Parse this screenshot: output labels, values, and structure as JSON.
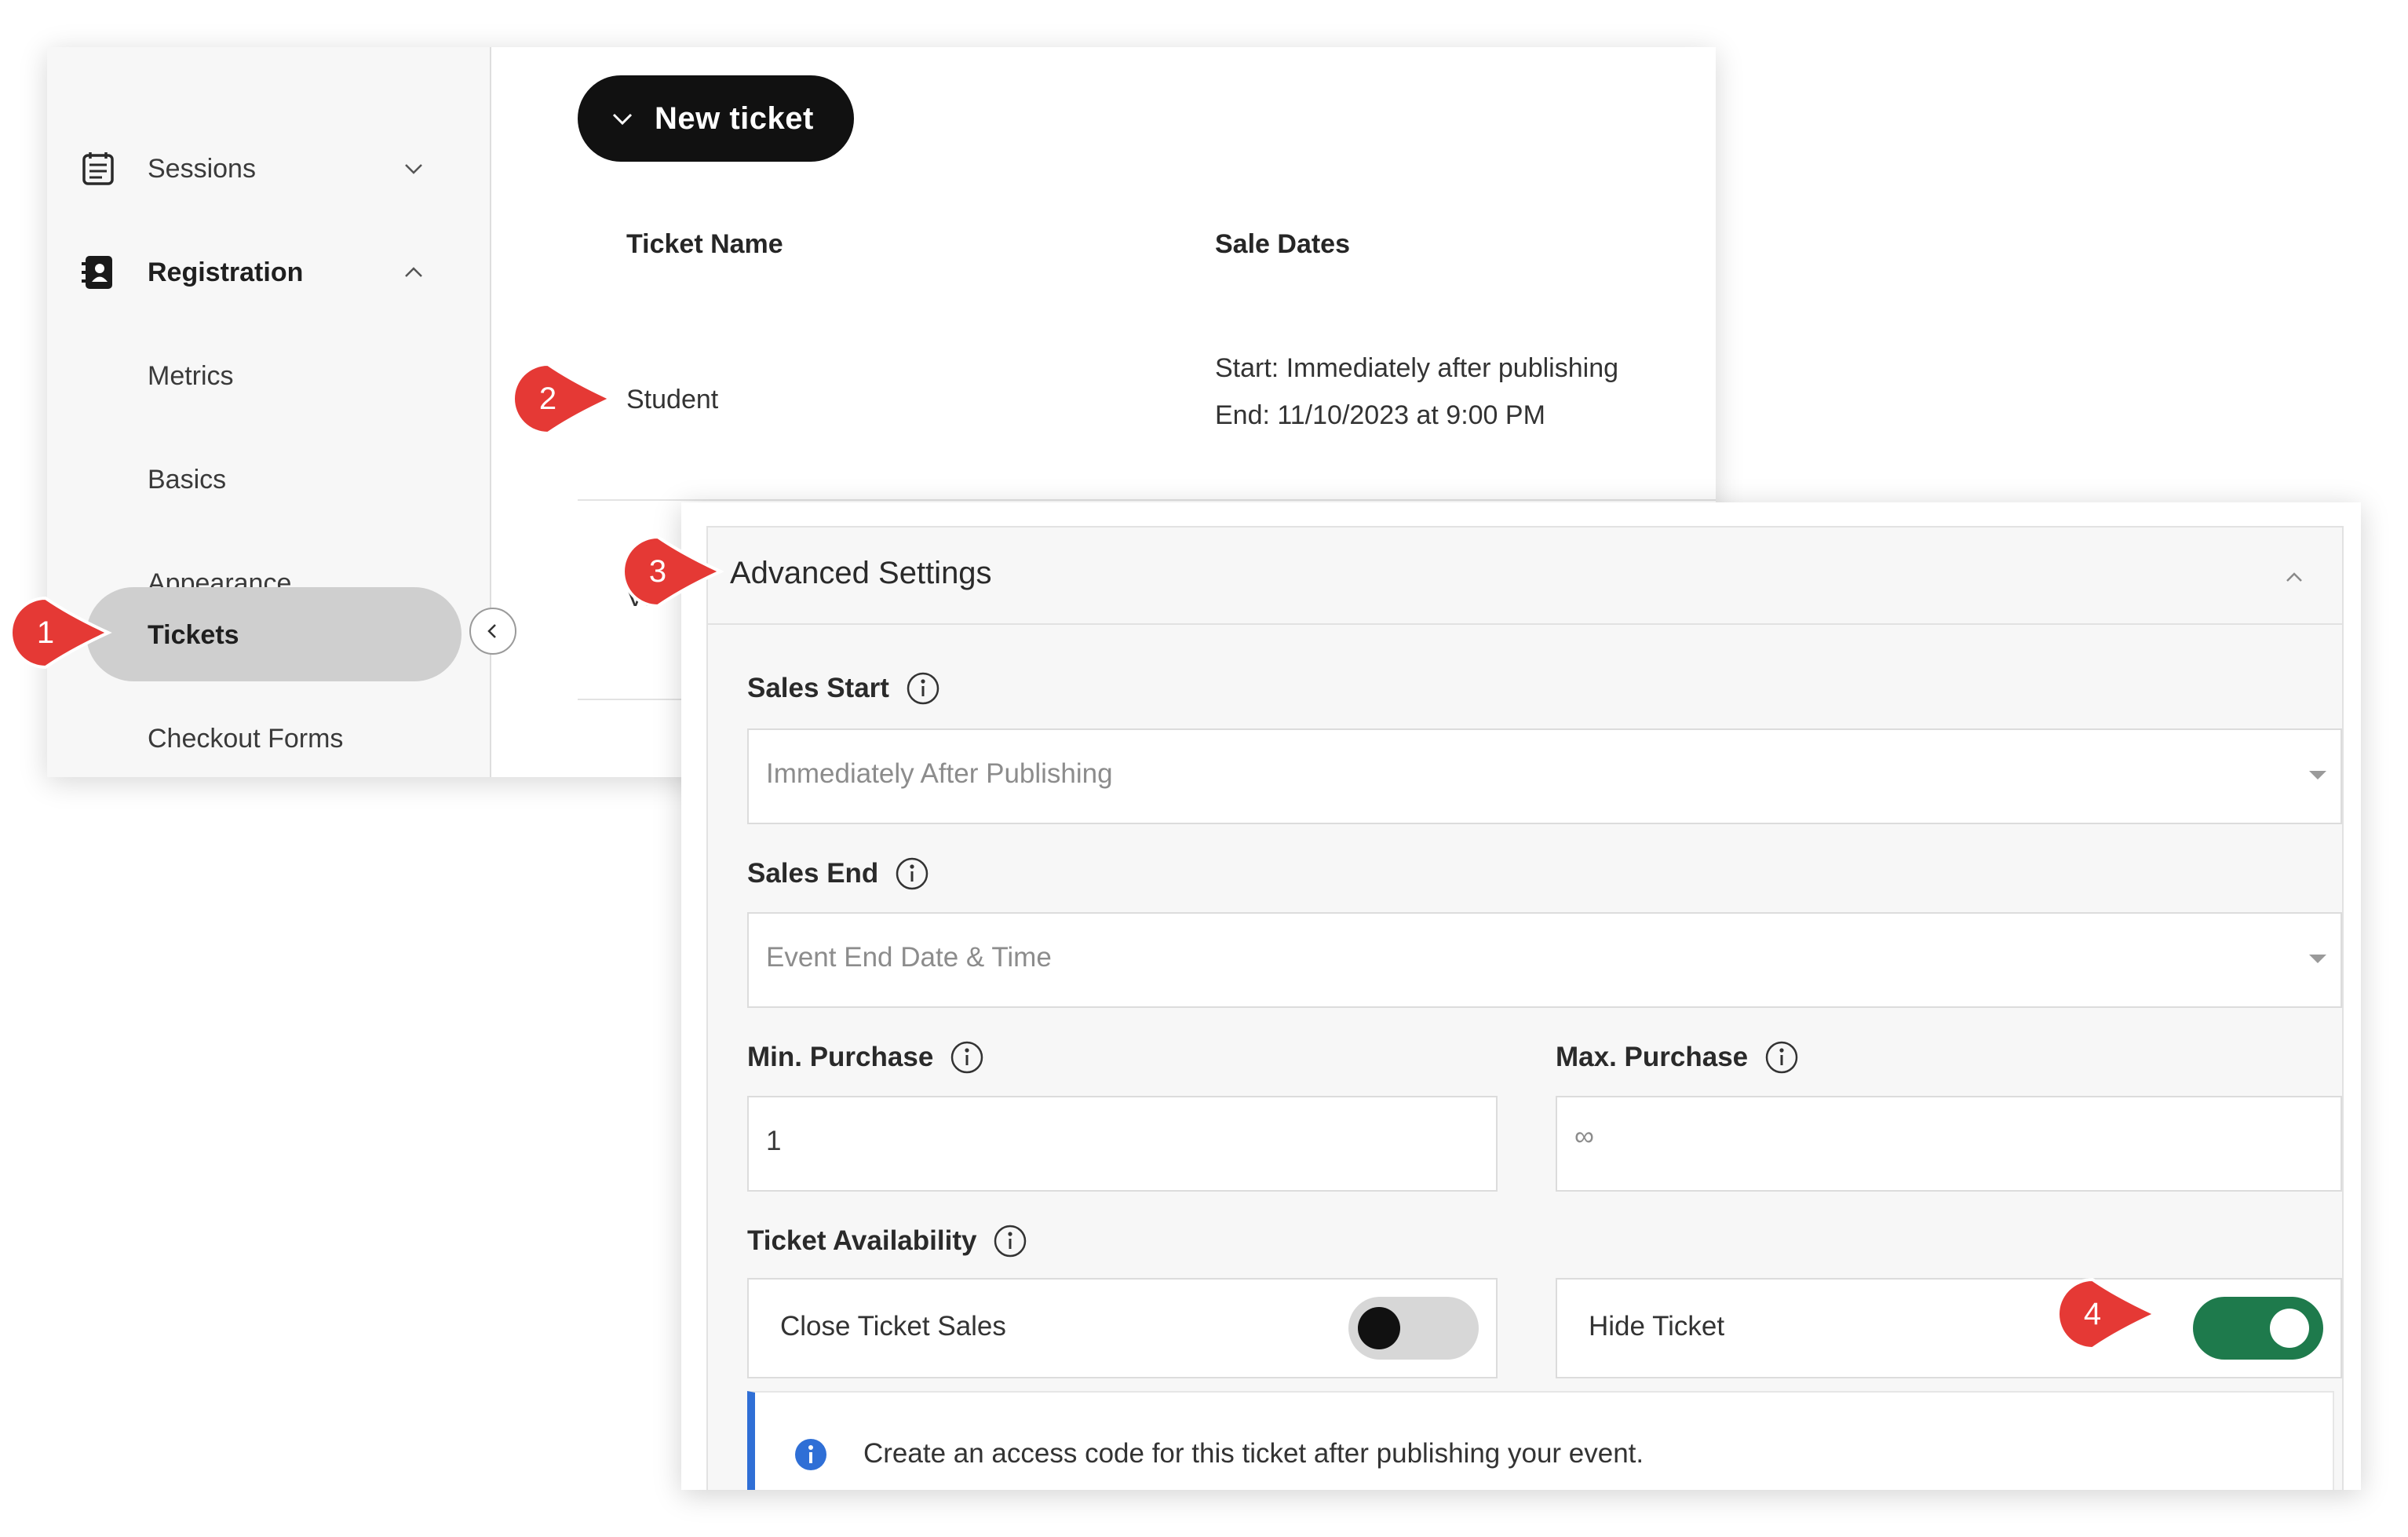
{
  "sidebar": {
    "items": [
      {
        "label": "Sessions",
        "icon": "calendar-list-icon",
        "expanded": false
      },
      {
        "label": "Registration",
        "icon": "contact-book-icon",
        "expanded": true
      },
      {
        "label": "Metrics"
      },
      {
        "label": "Basics"
      },
      {
        "label": "Appearance"
      },
      {
        "label": "Tickets",
        "active": true
      },
      {
        "label": "Checkout Forms"
      }
    ],
    "collapse_icon": "chevron-left-icon"
  },
  "main": {
    "new_ticket_label": "New ticket",
    "columns": [
      "Ticket Name",
      "Sale Dates"
    ],
    "rows": [
      {
        "name": "Student",
        "sale_start": "Start: Immediately after publishing",
        "sale_end": "End: 11/10/2023 at 9:00 PM"
      },
      {
        "name": "VIP"
      }
    ]
  },
  "advanced": {
    "title": "Advanced Settings",
    "sales_start": {
      "label": "Sales Start",
      "value": "Immediately After Publishing"
    },
    "sales_end": {
      "label": "Sales End",
      "value": "Event End Date & Time"
    },
    "min_purchase": {
      "label": "Min. Purchase",
      "value": "1"
    },
    "max_purchase": {
      "label": "Max. Purchase",
      "value": "∞"
    },
    "availability": {
      "label": "Ticket Availability",
      "close_sales": {
        "label": "Close Ticket Sales",
        "on": false
      },
      "hide_ticket": {
        "label": "Hide Ticket",
        "on": true
      }
    },
    "notice": "Create an access code for this ticket after publishing your event."
  },
  "callouts": [
    "1",
    "2",
    "3",
    "4"
  ],
  "colors": {
    "callout": "#e53935",
    "toggle_on": "#1e7a4c",
    "notice_accent": "#2f6fd6",
    "active_pill": "#cfcfcf"
  }
}
